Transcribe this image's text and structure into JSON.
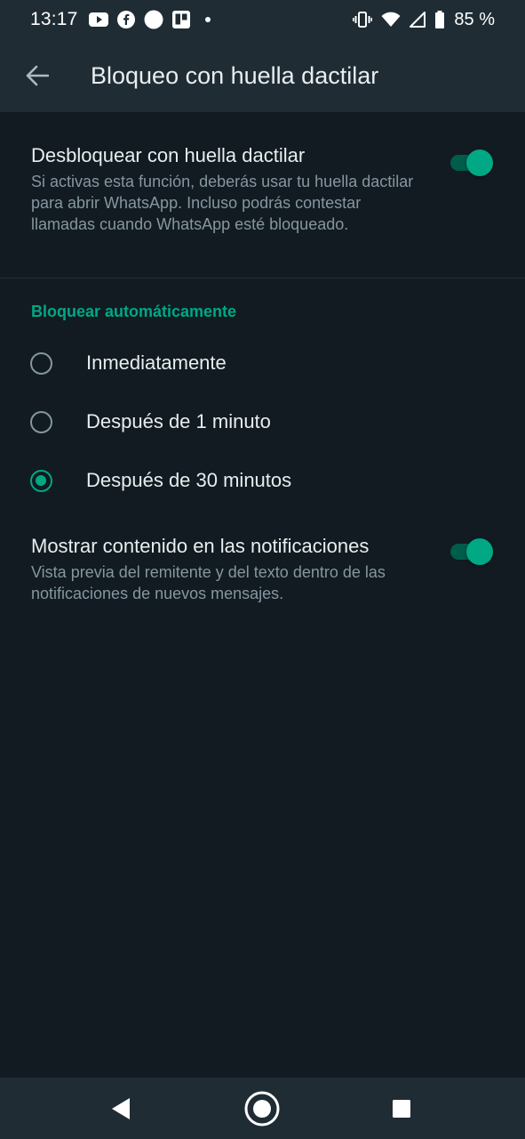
{
  "status_bar": {
    "time": "13:17",
    "notification_icons": [
      "youtube-icon",
      "facebook-icon",
      "circle-icon",
      "trello-icon",
      "dot-icon"
    ],
    "system_icons": [
      "vibrate-icon",
      "wifi-icon",
      "signal-icon",
      "battery-icon"
    ],
    "battery_text": "85 %"
  },
  "app_bar": {
    "title": "Bloqueo con huella dactilar"
  },
  "fingerprint_setting": {
    "title": "Desbloquear con huella dactilar",
    "description": "Si activas esta función, deberás usar tu huella dactilar para abrir WhatsApp. Incluso podrás contestar llamadas cuando WhatsApp esté bloqueado.",
    "enabled": true
  },
  "auto_lock": {
    "header": "Bloquear automáticamente",
    "options": [
      {
        "label": "Inmediatamente",
        "selected": false
      },
      {
        "label": "Después de 1 minuto",
        "selected": false
      },
      {
        "label": "Después de 30 minutos",
        "selected": true
      }
    ]
  },
  "notification_setting": {
    "title": "Mostrar contenido en las notificaciones",
    "description": "Vista previa del remitente y del texto dentro de las notificaciones de nuevos mensajes.",
    "enabled": true
  },
  "colors": {
    "background": "#111b21",
    "bar": "#1f2c34",
    "accent": "#00a884",
    "secondary_text": "#8696a0"
  }
}
